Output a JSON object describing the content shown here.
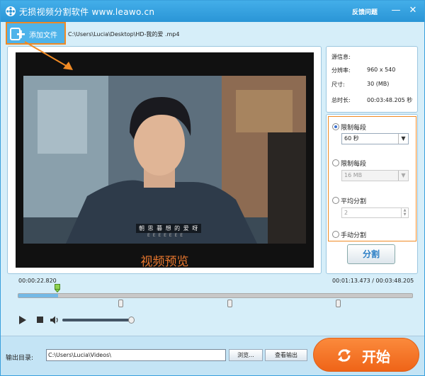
{
  "titlebar": {
    "title": "无损视频分割软件 www.leawo.cn",
    "feedback": "反馈问题",
    "minimize": "—",
    "close": "✕"
  },
  "toolbar": {
    "add_file_label": "添加文件",
    "file_path": "C:\\Users\\Lucia\\Desktop\\HD-我的爱 .mp4"
  },
  "preview": {
    "label": "视频预览",
    "subtitle_line1": "朝 思 暮 想 的 爱 呀",
    "subtitle_line2": "E E E E E E E"
  },
  "info": {
    "heading": "源信息:",
    "resolution_label": "分辨率:",
    "resolution_value": "960 x 540",
    "size_label": "尺寸:",
    "size_value": "30 (MB)",
    "duration_label": "总时长:",
    "duration_value": "00:03:48.205 秒"
  },
  "options": {
    "by_time_label": "限制每段",
    "by_time_value": "60 秒",
    "by_size_label": "限制每段",
    "by_size_value": "16 MB",
    "even_label": "平均分割",
    "even_value": "2",
    "manual_label": "手动分割",
    "split_button": "分割"
  },
  "timeline": {
    "current_time": "00:00:22.820",
    "range": "00:01:13.473 / 00:03:48.205",
    "progress_fraction": 0.1,
    "marker_fractions": [
      0.26,
      0.535,
      0.81
    ],
    "volume_fraction": 0.95
  },
  "footer": {
    "output_label": "输出目录:",
    "output_path": "C:\\Users\\Lucia\\Videos\\",
    "browse_button": "浏览...",
    "view_output_button": "查看输出",
    "start_button": "开始"
  },
  "colors": {
    "accent": "#2a95d6",
    "highlight": "#f08a24",
    "start": "#ef6418",
    "preview_label": "#e8772e"
  }
}
